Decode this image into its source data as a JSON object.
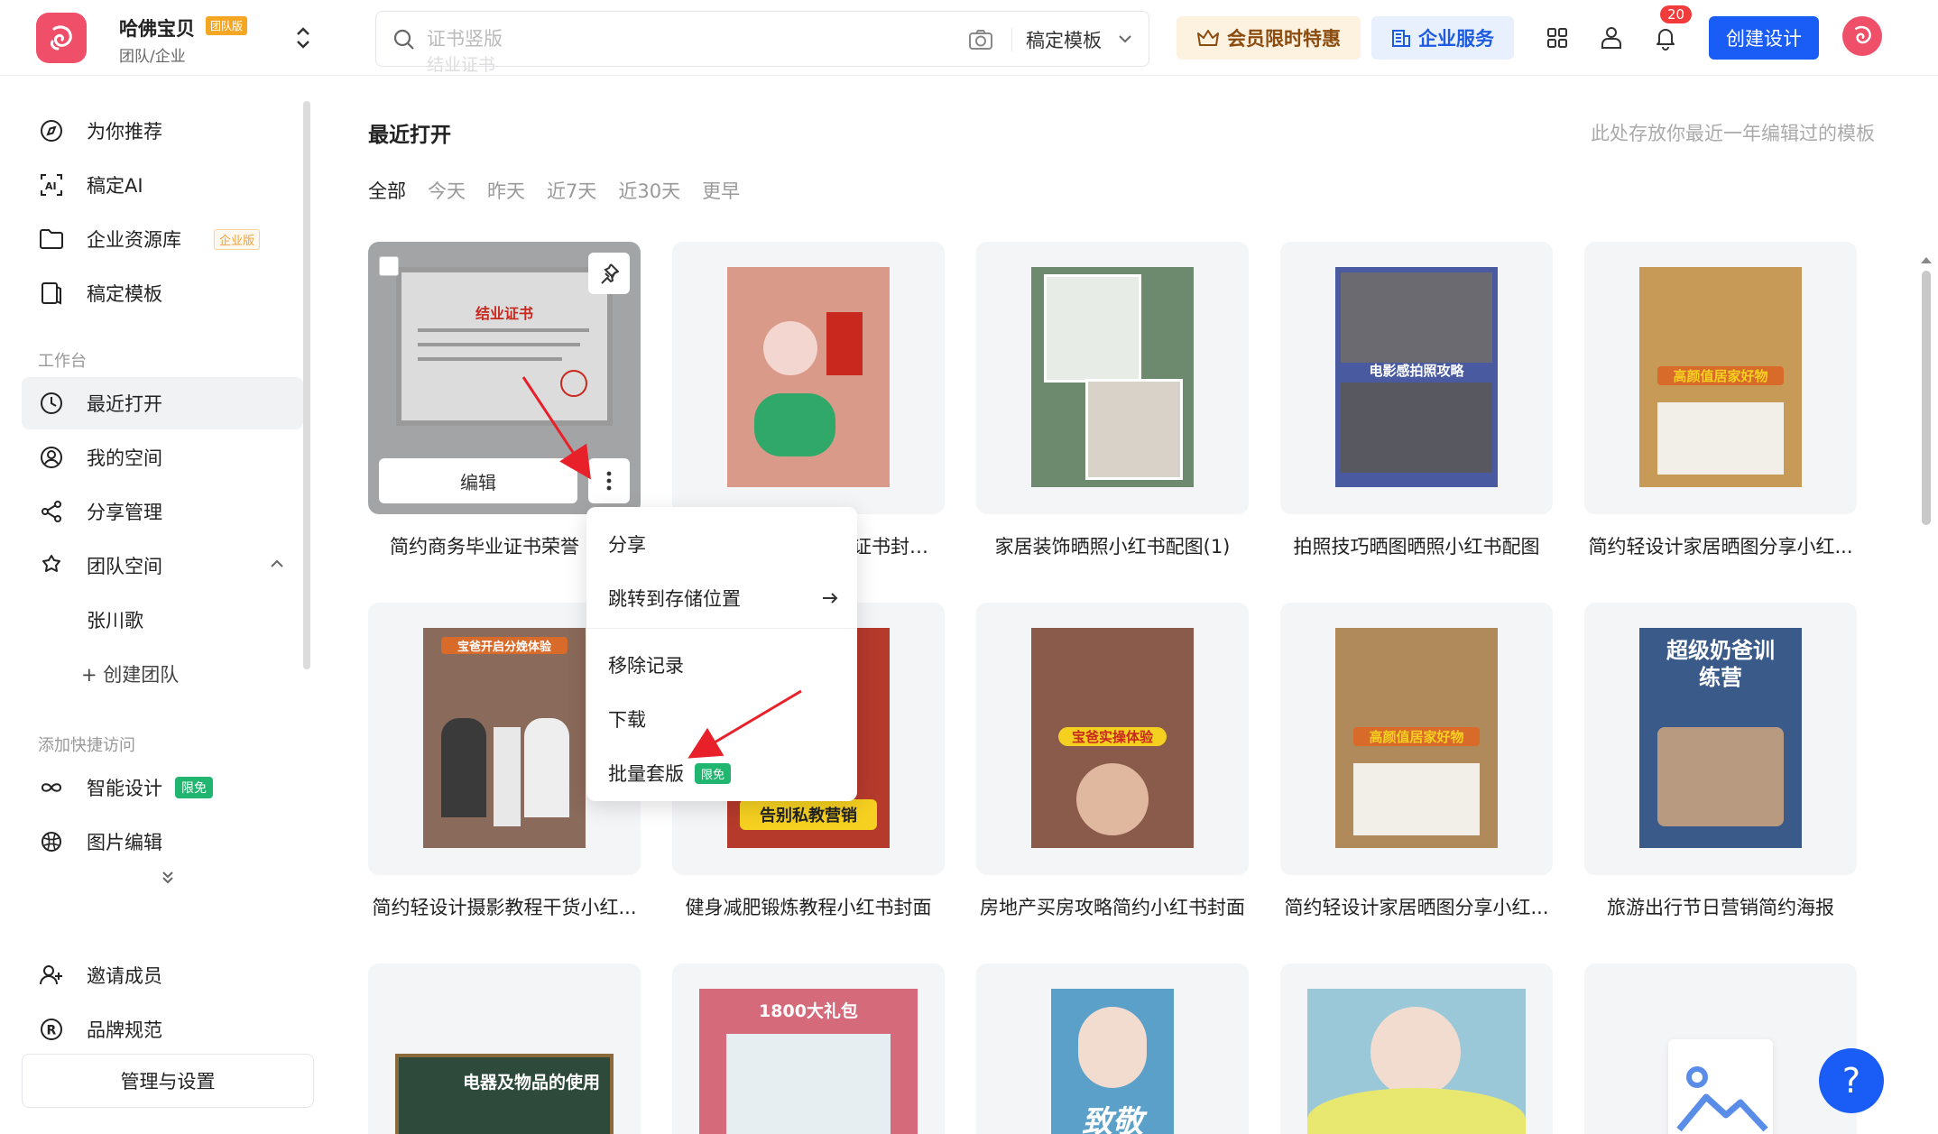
{
  "topbar": {
    "org_name": "哈佛宝贝",
    "org_badge": "团队版",
    "org_sub": "团队/企业",
    "search_placeholder": "证书竖版",
    "search_hint2": "结业证书",
    "search_scope": "稿定模板",
    "vip_label": "会员限时特惠",
    "enterprise_label": "企业服务",
    "notification_count": "20",
    "create_label": "创建设计"
  },
  "sidebar": {
    "items_top": [
      {
        "label": "为你推荐",
        "icon": "compass-icon"
      },
      {
        "label": "稿定AI",
        "icon": "ai-icon"
      },
      {
        "label": "企业资源库",
        "icon": "folder-icon",
        "tag": "企业版"
      },
      {
        "label": "稿定模板",
        "icon": "template-icon"
      }
    ],
    "workspace_label": "工作台",
    "workspace_items": [
      {
        "label": "最近打开",
        "icon": "clock-icon"
      },
      {
        "label": "我的空间",
        "icon": "user-circle-icon"
      },
      {
        "label": "分享管理",
        "icon": "share-icon"
      },
      {
        "label": "团队空间",
        "icon": "team-icon"
      }
    ],
    "team_member": "张川歌",
    "create_team": "+ 创建团队",
    "quick_label": "添加快捷访问",
    "quick_items": [
      {
        "label": "智能设计",
        "icon": "infinity-icon",
        "tag": "限免"
      },
      {
        "label": "图片编辑",
        "icon": "image-edit-icon"
      }
    ],
    "bottom_items": [
      {
        "label": "邀请成员",
        "icon": "add-user-icon"
      },
      {
        "label": "品牌规范",
        "icon": "registered-icon"
      }
    ],
    "manage_label": "管理与设置"
  },
  "main": {
    "title": "最近打开",
    "hint": "此处存放你最近一年编辑过的模板",
    "filters": [
      "全部",
      "今天",
      "昨天",
      "近7天",
      "近30天",
      "更早"
    ],
    "cards": [
      {
        "title": "简约商务毕业证书荣誉",
        "thumb_text": "结业证书",
        "thumb_color": "#d8d8d8"
      },
      {
        "title": "证书封面...",
        "thumb_text": "",
        "thumb_color": "#d99a8a"
      },
      {
        "title": "家居装饰晒照小红书配图(1)",
        "thumb_text": "",
        "thumb_color": "#6d8a6f"
      },
      {
        "title": "拍照技巧晒图晒照小红书配图",
        "thumb_text": "电影感拍照攻略",
        "thumb_color": "#4a5aa0"
      },
      {
        "title": "简约轻设计家居晒图分享小红...",
        "thumb_text": "高颜值居家好物",
        "thumb_color": "#c79a57"
      },
      {
        "title": "简约轻设计摄影教程干货小红...",
        "thumb_text": "宝爸开启分娩体验",
        "thumb_color": "#8a6a5a"
      },
      {
        "title": "健身减肥锻炼教程小红书封面",
        "thumb_text": "告别私教营销",
        "thumb_color": "#b53a2c"
      },
      {
        "title": "房地产买房攻略简约小红书封面",
        "thumb_text": "宝爸实操体验",
        "thumb_color": "#8a5a4a"
      },
      {
        "title": "简约轻设计家居晒图分享小红...",
        "thumb_text": "高颜值居家好物",
        "thumb_color": "#b08a5a"
      },
      {
        "title": "旅游出行节日营销简约海报",
        "thumb_text": "超级奶爸训练营",
        "thumb_color": "#3a5a8a"
      },
      {
        "title": "",
        "thumb_text": "电器及物品的使用",
        "thumb_color": "#2e4a3a"
      },
      {
        "title": "",
        "thumb_text": "1800大礼包",
        "thumb_color": "#d46a7a"
      },
      {
        "title": "",
        "thumb_text": "致敬",
        "thumb_color": "#5aa0c8"
      },
      {
        "title": "",
        "thumb_text": "",
        "thumb_color": "#9ac8d8"
      },
      {
        "title": "",
        "thumb_text": "",
        "thumb_color": "#ffffff"
      }
    ],
    "card_edit_label": "编辑"
  },
  "context_menu": {
    "share": "分享",
    "goto_storage": "跳转到存储位置",
    "remove_record": "移除记录",
    "download": "下载",
    "batch_template": "批量套版",
    "batch_tag": "限免"
  },
  "help_label": "?",
  "colors": {
    "accent": "#1a5cf6",
    "brand": "#ef4f68",
    "free_tag": "#21b66f",
    "arrow": "#e8202a"
  }
}
